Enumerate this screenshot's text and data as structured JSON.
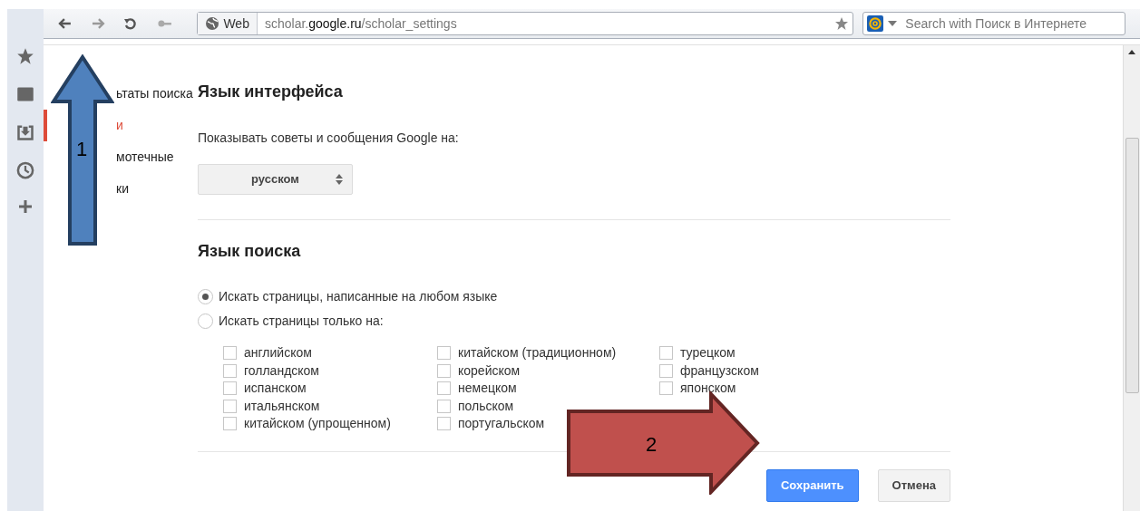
{
  "toolbar": {
    "web_label": "Web",
    "url": {
      "prefix": "scholar.",
      "host": "google.ru",
      "path": "/scholar_settings"
    },
    "search_placeholder": "Search with Поиск в Интернете"
  },
  "settings_nav": [
    {
      "label": "ьтаты поиска",
      "selected": false
    },
    {
      "label": "и",
      "selected": true
    },
    {
      "label": "мотечные",
      "selected": false
    },
    {
      "label": "ки",
      "selected": false
    }
  ],
  "interface_language": {
    "heading": "Язык интерфейса",
    "prompt": "Показывать советы и сообщения Google на:",
    "select_value": "русском"
  },
  "search_language": {
    "heading": "Язык поиска",
    "options": [
      {
        "label": "Искать страницы, написанные на любом языке",
        "selected": true
      },
      {
        "label": "Искать страницы только на:",
        "selected": false
      }
    ],
    "languages": [
      [
        {
          "label": "английском",
          "checked": false
        },
        {
          "label": "голландском",
          "checked": false
        },
        {
          "label": "испанском",
          "checked": false
        },
        {
          "label": "итальянском",
          "checked": false
        },
        {
          "label": "китайском (упрощенном)",
          "checked": false
        }
      ],
      [
        {
          "label": "китайском (традиционном)",
          "checked": false
        },
        {
          "label": "корейском",
          "checked": false
        },
        {
          "label": "немецком",
          "checked": false
        },
        {
          "label": "польском",
          "checked": false
        },
        {
          "label": "португальском",
          "checked": false
        }
      ],
      [
        {
          "label": "турецком",
          "checked": false
        },
        {
          "label": "французском",
          "checked": false
        },
        {
          "label": "японском",
          "checked": false
        }
      ]
    ]
  },
  "buttons": [
    {
      "label": "Сохранить",
      "kind": "primary"
    },
    {
      "label": "Отмена",
      "kind": "secondary"
    }
  ],
  "annotations": [
    {
      "label": "1",
      "kind": "up"
    },
    {
      "label": "2",
      "kind": "right"
    }
  ]
}
